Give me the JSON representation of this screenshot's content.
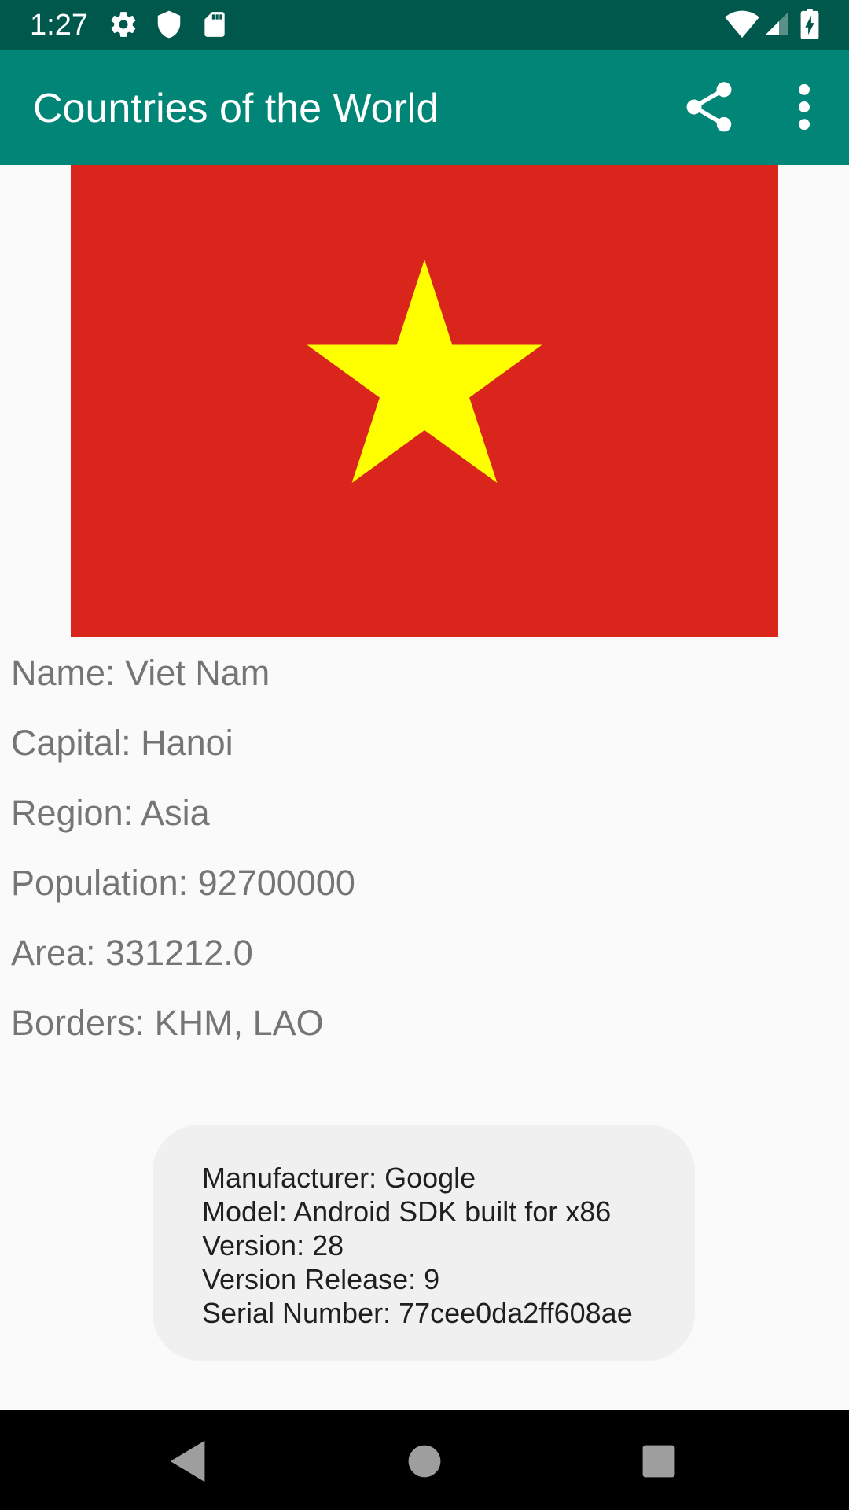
{
  "status_bar": {
    "time": "1:27",
    "left_icons": [
      "settings-icon",
      "shield-icon",
      "sd-card-icon"
    ],
    "right_icons": [
      "wifi-icon",
      "cell-signal-icon",
      "battery-charging-icon"
    ]
  },
  "app_bar": {
    "title": "Countries of the World",
    "actions": [
      "share-icon",
      "more-options-icon"
    ],
    "color": "#008577",
    "status_color": "#00574b"
  },
  "flag": {
    "country": "Viet Nam",
    "background_color": "#da251d",
    "star_color": "#ffff00"
  },
  "country_info": {
    "name": "Name: Viet Nam",
    "capital": "Capital: Hanoi",
    "region": "Region: Asia",
    "population": "Population: 92700000",
    "area": "Area: 331212.0",
    "borders": "Borders: KHM, LAO"
  },
  "device_toast": {
    "manufacturer": "Manufacturer: Google",
    "model": "Model: Android SDK built for x86",
    "version": "Version: 28",
    "version_release": "Version Release: 9",
    "serial_number": "Serial Number: 77cee0da2ff608ae"
  },
  "nav_bar": {
    "buttons": [
      "back-icon",
      "home-icon",
      "recents-icon"
    ]
  }
}
